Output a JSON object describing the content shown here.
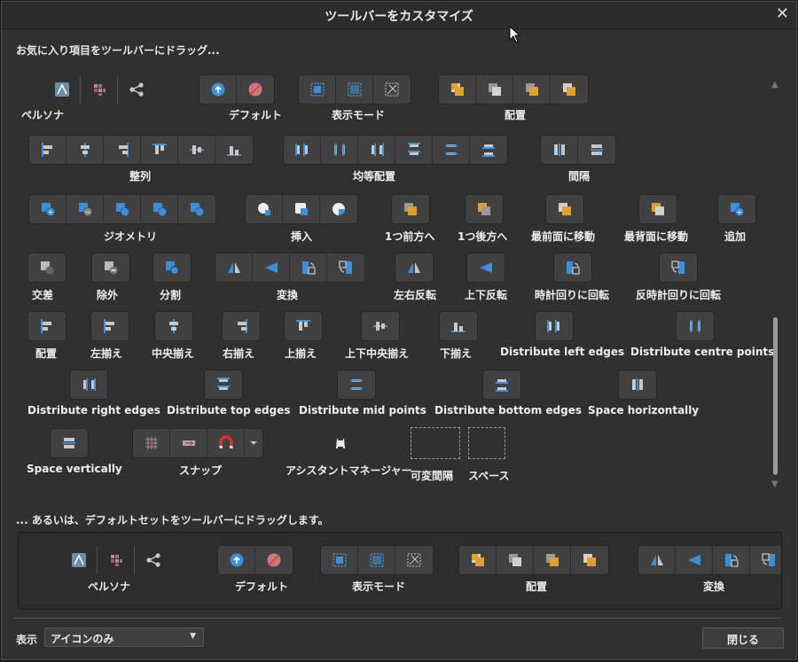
{
  "title": "ツールバーをカスタマイズ",
  "instruction_drag_items": "お気に入り項目をツールバーにドラッグ...",
  "instruction_drag_default": "... あるいは、デフォルトセットをツールバーにドラッグします。",
  "colors": {
    "accent_blue": "#3d8fd9",
    "accent_orange": "#e0a030"
  },
  "items": [
    {
      "label": "ペルソナ",
      "icons": [
        "affinity-persona-icon",
        "pixel-persona-icon",
        "export-persona-icon"
      ],
      "style": "flat"
    },
    {
      "label": "デフォルト",
      "icons": [
        "assistant-upload-icon",
        "assistant-disabled-icon"
      ]
    },
    {
      "label": "表示モード",
      "icons": [
        "view-mode-normal-icon",
        "view-mode-bleed-icon",
        "view-mode-wireframe-icon"
      ]
    },
    {
      "label": "配置",
      "icons": [
        "arrange-back-icon",
        "arrange-backward-icon",
        "arrange-forward-icon",
        "arrange-front-icon"
      ]
    },
    {
      "label": "整列",
      "icons": [
        "align-left-icon",
        "align-center-icon",
        "align-right-icon",
        "align-top-icon",
        "align-middle-icon",
        "align-bottom-icon"
      ]
    },
    {
      "label": "均等配置",
      "icons": [
        "distribute-left-icon",
        "distribute-centre-icon",
        "distribute-right-icon",
        "distribute-top-icon",
        "distribute-mid-icon",
        "distribute-bottom-icon"
      ]
    },
    {
      "label": "間隔",
      "icons": [
        "space-horizontal-icon",
        "space-vertical-icon"
      ]
    },
    {
      "label": "ジオメトリ",
      "icons": [
        "geometry-add-icon",
        "geometry-subtract-icon",
        "geometry-intersect-icon",
        "geometry-xor-icon",
        "geometry-divide-icon"
      ]
    },
    {
      "label": "挿入",
      "icons": [
        "insert-behind-icon",
        "insert-top-icon",
        "insert-inside-icon"
      ]
    },
    {
      "label": "1つ前方へ",
      "icons": [
        "forward-one-icon"
      ]
    },
    {
      "label": "1つ後方へ",
      "icons": [
        "back-one-icon"
      ]
    },
    {
      "label": "最前面に移動",
      "icons": [
        "to-front-icon"
      ]
    },
    {
      "label": "最背面に移動",
      "icons": [
        "to-back-icon"
      ]
    },
    {
      "label": "追加",
      "icons": [
        "add-icon"
      ]
    },
    {
      "label": "交差",
      "icons": [
        "intersect-icon"
      ]
    },
    {
      "label": "除外",
      "icons": [
        "subtract-icon"
      ]
    },
    {
      "label": "分割",
      "icons": [
        "divide-icon"
      ]
    },
    {
      "label": "変換",
      "icons": [
        "flip-horizontal-icon",
        "flip-vertical-icon",
        "rotate-right-icon",
        "rotate-left-icon"
      ]
    },
    {
      "label": "左右反転",
      "icons": [
        "flip-horizontal-icon"
      ]
    },
    {
      "label": "上下反転",
      "icons": [
        "flip-vertical-icon"
      ]
    },
    {
      "label": "時計回りに回転",
      "icons": [
        "rotate-right-icon"
      ]
    },
    {
      "label": "反時計回りに回転",
      "icons": [
        "rotate-left-icon"
      ]
    },
    {
      "label": "配置",
      "icons": [
        "align-left-icon"
      ]
    },
    {
      "label": "左揃え",
      "icons": [
        "align-left-icon"
      ]
    },
    {
      "label": "中央揃え",
      "icons": [
        "align-center-icon"
      ]
    },
    {
      "label": "右揃え",
      "icons": [
        "align-right-icon"
      ]
    },
    {
      "label": "上揃え",
      "icons": [
        "align-top-icon"
      ]
    },
    {
      "label": "上下中央揃え",
      "icons": [
        "align-middle-icon"
      ]
    },
    {
      "label": "下揃え",
      "icons": [
        "align-bottom-icon"
      ]
    },
    {
      "label": "Distribute left edges",
      "icons": [
        "distribute-left-icon"
      ]
    },
    {
      "label": "Distribute centre points",
      "icons": [
        "distribute-centre-icon"
      ]
    },
    {
      "label": "Distribute right edges",
      "icons": [
        "distribute-right-icon"
      ]
    },
    {
      "label": "Distribute top edges",
      "icons": [
        "distribute-top-icon"
      ]
    },
    {
      "label": "Distribute mid points",
      "icons": [
        "distribute-mid-icon"
      ]
    },
    {
      "label": "Distribute bottom edges",
      "icons": [
        "distribute-bottom-icon"
      ]
    },
    {
      "label": "Space horizontally",
      "icons": [
        "space-horizontal-icon"
      ]
    },
    {
      "label": "Space vertically",
      "icons": [
        "space-vertical-icon"
      ]
    },
    {
      "label": "スナップ",
      "icons": [
        "snapping-grid-icon",
        "snapping-settings-icon",
        "snapping-magnet-icon",
        "chevron-down-icon"
      ]
    },
    {
      "label": "アシスタントマネージャー",
      "icons": [
        "assistant-manager-icon"
      ],
      "style": "flat"
    },
    {
      "label": "可変間隔",
      "icons": [],
      "style": "dashed"
    },
    {
      "label": "スペース",
      "icons": [],
      "style": "dashed"
    }
  ],
  "default_set": [
    {
      "label": "ペルソナ",
      "icons": [
        "affinity-persona-icon",
        "pixel-persona-icon",
        "export-persona-icon"
      ],
      "style": "flat"
    },
    {
      "label": "デフォルト",
      "icons": [
        "assistant-upload-icon",
        "assistant-disabled-icon"
      ]
    },
    {
      "label": "表示モード",
      "icons": [
        "view-mode-normal-icon",
        "view-mode-bleed-icon",
        "view-mode-wireframe-icon"
      ]
    },
    {
      "label": "配置",
      "icons": [
        "arrange-back-icon",
        "arrange-backward-icon",
        "arrange-forward-icon",
        "arrange-front-icon"
      ]
    },
    {
      "label": "変換",
      "icons": [
        "flip-horizontal-icon",
        "flip-vertical-icon",
        "rotate-right-icon",
        "rotate-left-icon"
      ]
    }
  ],
  "show_label": "表示",
  "show_select_value": "アイコンのみ",
  "close_button": "閉じる"
}
